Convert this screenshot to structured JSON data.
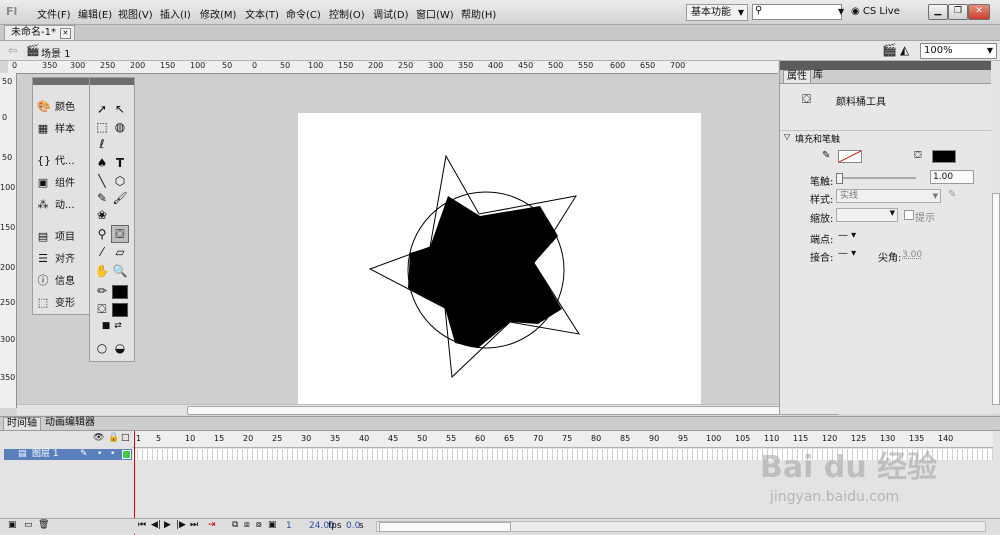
{
  "menubar": {
    "logo": "Fl",
    "items": [
      "文件(F)",
      "编辑(E)",
      "视图(V)",
      "插入(I)",
      "修改(M)",
      "文本(T)",
      "命令(C)",
      "控制(O)",
      "调试(D)",
      "窗口(W)",
      "帮助(H)"
    ],
    "workspace": "基本功能",
    "cslive": "CS Live"
  },
  "document": {
    "tab": "未命名-1*",
    "scene": "场景 1",
    "zoom": "100%"
  },
  "rulers": {
    "top": [
      "0",
      "350",
      "300",
      "250",
      "200",
      "150",
      "100",
      "50",
      "0",
      "50",
      "100",
      "150",
      "200",
      "250",
      "300",
      "350",
      "400",
      "450",
      "500",
      "550",
      "600",
      "650",
      "700"
    ],
    "left": [
      "50",
      "0",
      "50",
      "100",
      "150",
      "200",
      "250",
      "300",
      "350"
    ]
  },
  "dock": {
    "items": [
      "颜色",
      "样本",
      "代...",
      "组件",
      "动...",
      "项目",
      "对齐",
      "信息",
      "变形"
    ]
  },
  "properties": {
    "tab_active": "属性",
    "tab_other": "库",
    "tool_name": "颜料桶工具",
    "section": "填充和笔触",
    "stroke_label": "笔触:",
    "stroke_value": "1.00",
    "style_label": "样式:",
    "style_value": "实线",
    "scale_label": "缩放:",
    "hint_label": "提示",
    "cap_label": "端点:",
    "join_label": "接合:",
    "miter_label": "尖角:",
    "miter_value": "3.00"
  },
  "timeline": {
    "tab_active": "时间轴",
    "tab_other": "动画编辑器",
    "layer_name": "图层 1",
    "frame_numbers": [
      "1",
      "5",
      "10",
      "15",
      "20",
      "25",
      "30",
      "35",
      "40",
      "45",
      "50",
      "55",
      "60",
      "65",
      "70",
      "75",
      "80",
      "85",
      "90",
      "95",
      "100",
      "105",
      "110",
      "115",
      "120",
      "125",
      "130",
      "135",
      "140"
    ],
    "current_frame": "1",
    "fps": "24.00",
    "fps_unit": "fps",
    "time": "0.0",
    "time_unit": "s"
  },
  "watermark": {
    "brand": "Bai du 经验",
    "url": "jingyan.baidu.com"
  }
}
